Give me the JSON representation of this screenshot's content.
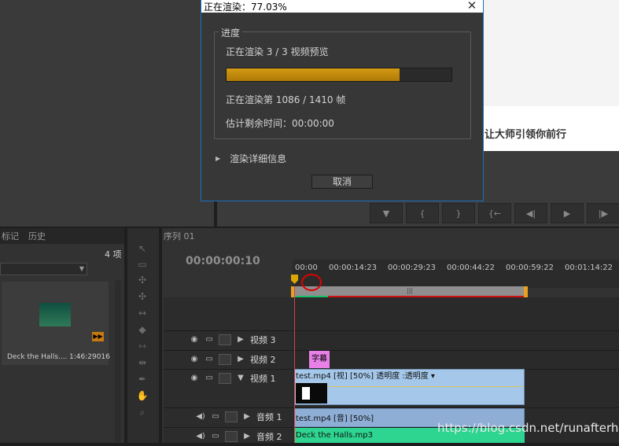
{
  "dialog": {
    "title": "正在渲染：77.03%",
    "group_label": "进度",
    "status_line": "正在渲染 3 / 3 视频预览",
    "progress_fraction": 0.7703,
    "frame_line": "正在渲染第 1086 / 1410 帧",
    "remaining_line": "估计剩余时间：00:00:00",
    "details_label": "渲染详细信息",
    "cancel_label": "取消",
    "close_glyph": "✕"
  },
  "background_web": {
    "headline": "让大师引领你前行"
  },
  "transport": {
    "buttons": [
      "▼",
      "{",
      "}",
      "{←",
      "◀|",
      "▶",
      "|▶"
    ]
  },
  "project_panel": {
    "tabs": [
      "标记",
      "历史"
    ],
    "item_count": "4 项",
    "item_name": "Deck the Halls....",
    "item_duration": "1:46:29016"
  },
  "tools": [
    "select",
    "track-select",
    "ripple",
    "rolling",
    "rate",
    "razor",
    "slip",
    "slide",
    "pen",
    "hand",
    "zoom"
  ],
  "timeline": {
    "tab_label": "序列 01",
    "timecode": "00:00:00:10",
    "ruler_ticks": [
      "00:00",
      "00:00:14:23",
      "00:00:29:23",
      "00:00:44:22",
      "00:00:59:22",
      "00:01:14:22"
    ],
    "work_area_center": "|||",
    "tracks": [
      {
        "name": "视频 3"
      },
      {
        "name": "视频 2"
      },
      {
        "name": "视频 1"
      },
      {
        "name": "音频 1"
      },
      {
        "name": "音频 2"
      }
    ],
    "clips": {
      "subtitle": "字幕",
      "video": "test.mp4 [视] [50%]  透明度 :透明度 ▾",
      "audio1": "test.mp4 [音] [50%]",
      "audio2": "Deck the Halls.mp3"
    }
  },
  "watermark": "https://blog.csdn.net/runafterhit"
}
